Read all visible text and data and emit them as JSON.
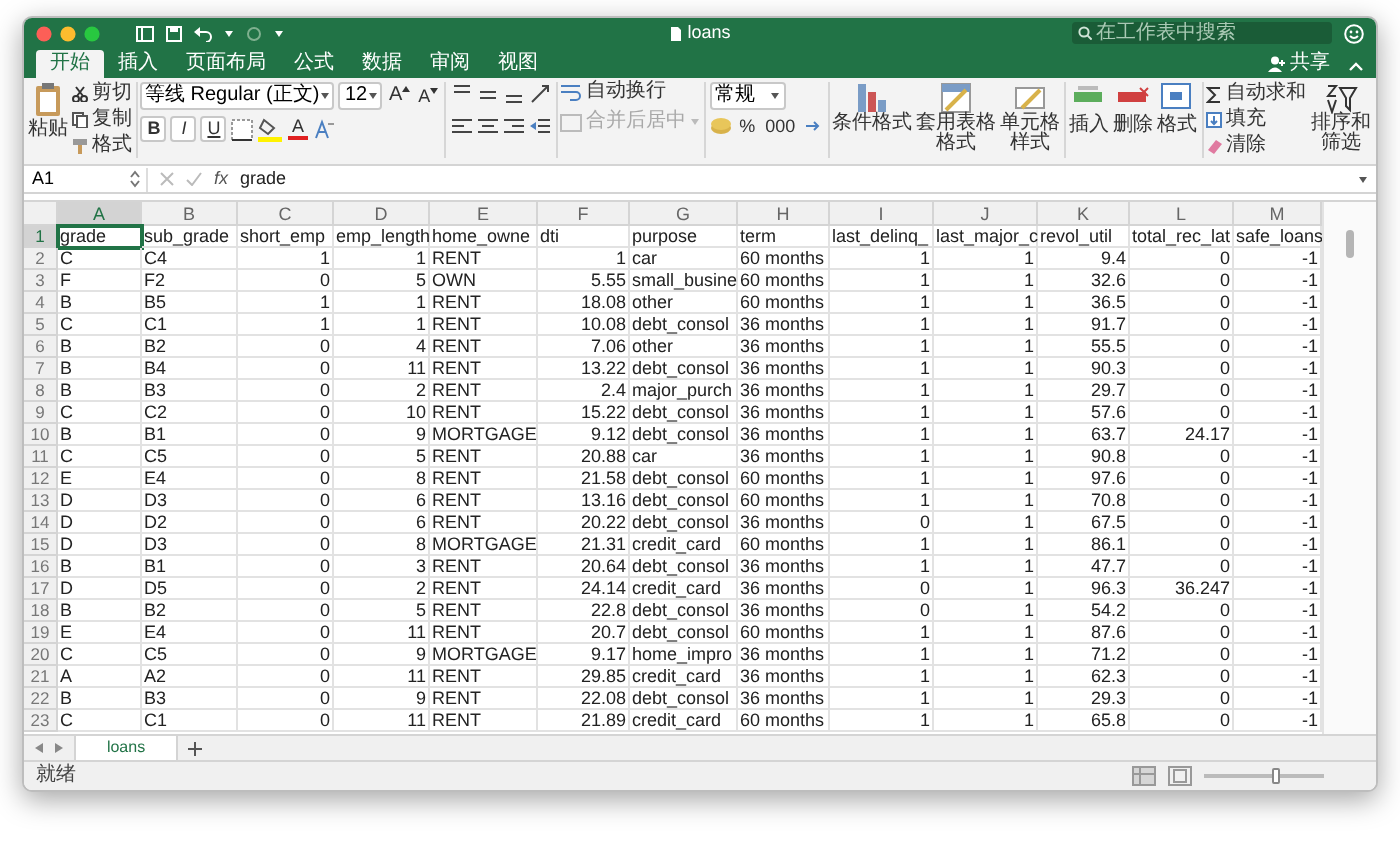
{
  "window": {
    "title": "loans",
    "search": {
      "placeholder": "在工作表中搜索"
    }
  },
  "tabs": [
    {
      "label": "开始",
      "selected": true
    },
    {
      "label": "插入",
      "selected": false
    },
    {
      "label": "页面布局",
      "selected": false
    },
    {
      "label": "公式",
      "selected": false
    },
    {
      "label": "数据",
      "selected": false
    },
    {
      "label": "审阅",
      "selected": false
    },
    {
      "label": "视图",
      "selected": false
    }
  ],
  "share": "共享",
  "ribbon": {
    "paste": "粘贴",
    "clipboard": [
      {
        "kind": "cut",
        "label": "剪切"
      },
      {
        "kind": "copy",
        "label": "复制"
      },
      {
        "kind": "format",
        "label": "格式"
      }
    ],
    "font": {
      "name": "等线 Regular (正文)",
      "size": "12",
      "grow": "A",
      "shrink": "A",
      "styles": [
        "B",
        "I",
        "U"
      ],
      "font_color": "A"
    },
    "wrap": "自动换行",
    "merge": {
      "label": "合并后居中",
      "disabled": true
    },
    "number_format": "常规",
    "number_buttons": [
      "%",
      "000"
    ],
    "styles": [
      "条件格式",
      "套用表格格式",
      "单元格样式"
    ],
    "cells": [
      "插入",
      "删除",
      "格式"
    ],
    "editing": [
      {
        "kind": "sum",
        "label": "自动求和"
      },
      {
        "kind": "fill",
        "label": "填充"
      },
      {
        "kind": "clear",
        "label": "清除"
      }
    ],
    "sort": "排序和筛选"
  },
  "formula_bar": {
    "name_box": "A1",
    "fx": "fx",
    "value": "grade"
  },
  "sheet": {
    "columns": [
      {
        "letter": "A",
        "kind": "text",
        "selected": true
      },
      {
        "letter": "B",
        "kind": "text",
        "selected": false
      },
      {
        "letter": "C",
        "kind": "number",
        "selected": false
      },
      {
        "letter": "D",
        "kind": "number",
        "selected": false
      },
      {
        "letter": "E",
        "kind": "text",
        "selected": false
      },
      {
        "letter": "F",
        "kind": "number",
        "selected": false
      },
      {
        "letter": "G",
        "kind": "text",
        "selected": false
      },
      {
        "letter": "H",
        "kind": "text",
        "selected": false
      },
      {
        "letter": "I",
        "kind": "number",
        "selected": false
      },
      {
        "letter": "J",
        "kind": "number",
        "selected": false
      },
      {
        "letter": "K",
        "kind": "number",
        "selected": false
      },
      {
        "letter": "L",
        "kind": "number",
        "selected": false
      },
      {
        "letter": "M",
        "kind": "number",
        "selected": false
      }
    ],
    "rows": [
      {
        "number": "1",
        "kind": "header",
        "selected": true,
        "cells": [
          "grade",
          "sub_grade",
          "short_emp",
          "emp_length",
          "home_owne",
          "dti",
          "purpose",
          "term",
          "last_delinq_",
          "last_major_c",
          "revol_util",
          "total_rec_lat",
          "safe_loans"
        ]
      },
      {
        "number": "2",
        "kind": "data",
        "selected": false,
        "cells": [
          "C",
          "C4",
          "1",
          "1",
          "RENT",
          "1",
          "car",
          "60 months",
          "1",
          "1",
          "9.4",
          "0",
          "-1"
        ]
      },
      {
        "number": "3",
        "kind": "data",
        "selected": false,
        "cells": [
          "F",
          "F2",
          "0",
          "5",
          "OWN",
          "5.55",
          "small_busine",
          "60 months",
          "1",
          "1",
          "32.6",
          "0",
          "-1"
        ]
      },
      {
        "number": "4",
        "kind": "data",
        "selected": false,
        "cells": [
          "B",
          "B5",
          "1",
          "1",
          "RENT",
          "18.08",
          "other",
          "60 months",
          "1",
          "1",
          "36.5",
          "0",
          "-1"
        ]
      },
      {
        "number": "5",
        "kind": "data",
        "selected": false,
        "cells": [
          "C",
          "C1",
          "1",
          "1",
          "RENT",
          "10.08",
          "debt_consol",
          "36 months",
          "1",
          "1",
          "91.7",
          "0",
          "-1"
        ]
      },
      {
        "number": "6",
        "kind": "data",
        "selected": false,
        "cells": [
          "B",
          "B2",
          "0",
          "4",
          "RENT",
          "7.06",
          "other",
          "36 months",
          "1",
          "1",
          "55.5",
          "0",
          "-1"
        ]
      },
      {
        "number": "7",
        "kind": "data",
        "selected": false,
        "cells": [
          "B",
          "B4",
          "0",
          "11",
          "RENT",
          "13.22",
          "debt_consol",
          "36 months",
          "1",
          "1",
          "90.3",
          "0",
          "-1"
        ]
      },
      {
        "number": "8",
        "kind": "data",
        "selected": false,
        "cells": [
          "B",
          "B3",
          "0",
          "2",
          "RENT",
          "2.4",
          "major_purch",
          "36 months",
          "1",
          "1",
          "29.7",
          "0",
          "-1"
        ]
      },
      {
        "number": "9",
        "kind": "data",
        "selected": false,
        "cells": [
          "C",
          "C2",
          "0",
          "10",
          "RENT",
          "15.22",
          "debt_consol",
          "36 months",
          "1",
          "1",
          "57.6",
          "0",
          "-1"
        ]
      },
      {
        "number": "10",
        "kind": "data",
        "selected": false,
        "cells": [
          "B",
          "B1",
          "0",
          "9",
          "MORTGAGE",
          "9.12",
          "debt_consol",
          "36 months",
          "1",
          "1",
          "63.7",
          "24.17",
          "-1"
        ]
      },
      {
        "number": "11",
        "kind": "data",
        "selected": false,
        "cells": [
          "C",
          "C5",
          "0",
          "5",
          "RENT",
          "20.88",
          "car",
          "36 months",
          "1",
          "1",
          "90.8",
          "0",
          "-1"
        ]
      },
      {
        "number": "12",
        "kind": "data",
        "selected": false,
        "cells": [
          "E",
          "E4",
          "0",
          "8",
          "RENT",
          "21.58",
          "debt_consol",
          "60 months",
          "1",
          "1",
          "97.6",
          "0",
          "-1"
        ]
      },
      {
        "number": "13",
        "kind": "data",
        "selected": false,
        "cells": [
          "D",
          "D3",
          "0",
          "6",
          "RENT",
          "13.16",
          "debt_consol",
          "60 months",
          "1",
          "1",
          "70.8",
          "0",
          "-1"
        ]
      },
      {
        "number": "14",
        "kind": "data",
        "selected": false,
        "cells": [
          "D",
          "D2",
          "0",
          "6",
          "RENT",
          "20.22",
          "debt_consol",
          "36 months",
          "0",
          "1",
          "67.5",
          "0",
          "-1"
        ]
      },
      {
        "number": "15",
        "kind": "data",
        "selected": false,
        "cells": [
          "D",
          "D3",
          "0",
          "8",
          "MORTGAGE",
          "21.31",
          "credit_card",
          "60 months",
          "1",
          "1",
          "86.1",
          "0",
          "-1"
        ]
      },
      {
        "number": "16",
        "kind": "data",
        "selected": false,
        "cells": [
          "B",
          "B1",
          "0",
          "3",
          "RENT",
          "20.64",
          "debt_consol",
          "36 months",
          "1",
          "1",
          "47.7",
          "0",
          "-1"
        ]
      },
      {
        "number": "17",
        "kind": "data",
        "selected": false,
        "cells": [
          "D",
          "D5",
          "0",
          "2",
          "RENT",
          "24.14",
          "credit_card",
          "36 months",
          "0",
          "1",
          "96.3",
          "36.247",
          "-1"
        ]
      },
      {
        "number": "18",
        "kind": "data",
        "selected": false,
        "cells": [
          "B",
          "B2",
          "0",
          "5",
          "RENT",
          "22.8",
          "debt_consol",
          "36 months",
          "0",
          "1",
          "54.2",
          "0",
          "-1"
        ]
      },
      {
        "number": "19",
        "kind": "data",
        "selected": false,
        "cells": [
          "E",
          "E4",
          "0",
          "11",
          "RENT",
          "20.7",
          "debt_consol",
          "60 months",
          "1",
          "1",
          "87.6",
          "0",
          "-1"
        ]
      },
      {
        "number": "20",
        "kind": "data",
        "selected": false,
        "cells": [
          "C",
          "C5",
          "0",
          "9",
          "MORTGAGE",
          "9.17",
          "home_impro",
          "36 months",
          "1",
          "1",
          "71.2",
          "0",
          "-1"
        ]
      },
      {
        "number": "21",
        "kind": "data",
        "selected": false,
        "cells": [
          "A",
          "A2",
          "0",
          "11",
          "RENT",
          "29.85",
          "credit_card",
          "36 months",
          "1",
          "1",
          "62.3",
          "0",
          "-1"
        ]
      },
      {
        "number": "22",
        "kind": "data",
        "selected": false,
        "cells": [
          "B",
          "B3",
          "0",
          "9",
          "RENT",
          "22.08",
          "debt_consol",
          "36 months",
          "1",
          "1",
          "29.3",
          "0",
          "-1"
        ]
      },
      {
        "number": "23",
        "kind": "data",
        "selected": false,
        "cells": [
          "C",
          "C1",
          "0",
          "11",
          "RENT",
          "21.89",
          "credit_card",
          "60 months",
          "1",
          "1",
          "65.8",
          "0",
          "-1"
        ]
      }
    ]
  },
  "sheet_tabs": [
    {
      "label": "loans",
      "selected": true
    }
  ],
  "status_bar": {
    "text": "就绪",
    "zoom": {
      "level": 0.6
    }
  }
}
